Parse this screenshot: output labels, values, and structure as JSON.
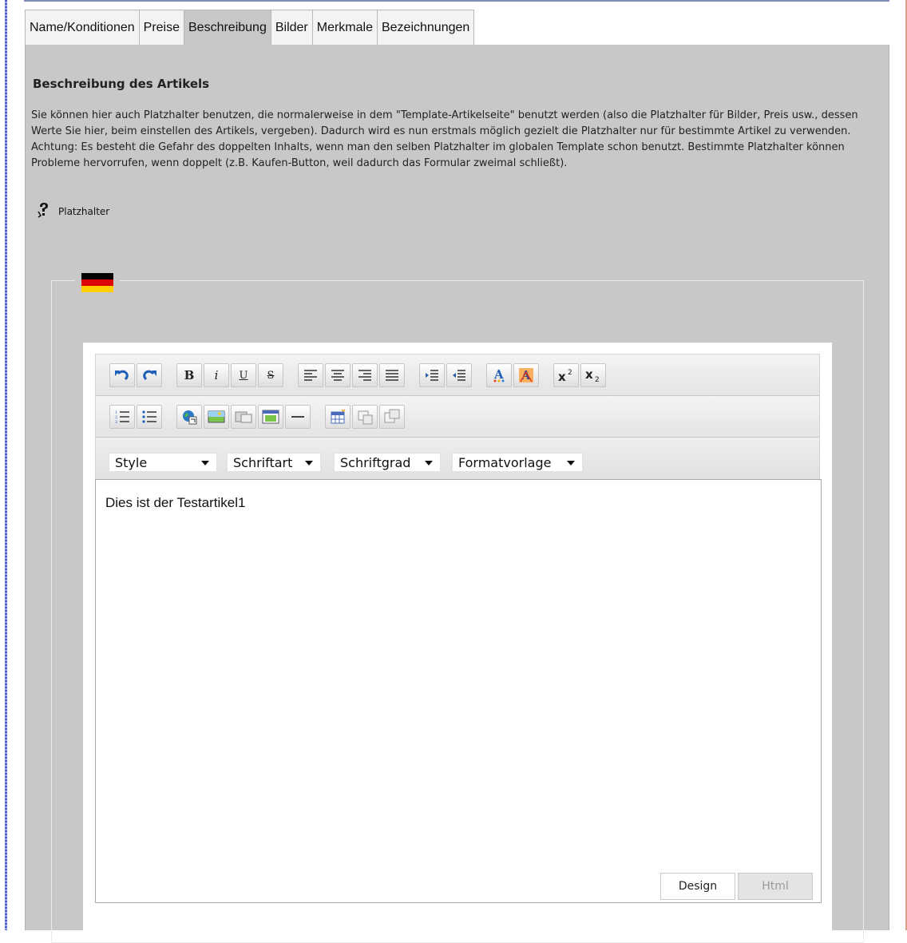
{
  "tabs": [
    {
      "label": "Name/Konditionen"
    },
    {
      "label": "Preise"
    },
    {
      "label": "Beschreibung"
    },
    {
      "label": "Bilder"
    },
    {
      "label": "Merkmale"
    },
    {
      "label": "Bezeichnungen"
    }
  ],
  "active_tab": "Beschreibung",
  "section": {
    "title": "Beschreibung des Artikels",
    "description": "Sie können hier auch Platzhalter benutzen, die normalerweise in dem \"Template-Artikelseite\" benutzt werden (also die Platzhalter für Bilder, Preis usw., dessen Werte Sie hier, beim einstellen des Artikels, vergeben). Dadurch wird es nun erstmals möglich gezielt die Platzhalter nur für bestimmte Artikel zu verwenden. Achtung: Es besteht die Gefahr des doppelten Inhalts, wenn man den selben Platzhalter im globalen Template schon benutzt. Bestimmte Platzhalter können Probleme hervorrufen, wenn doppelt (z.B. Kaufen-Button, weil dadurch das Formular zweimal schließt).",
    "placeholder_link": "Platzhalter"
  },
  "language_flag": "de-flag-icon",
  "toolbar": {
    "bold_glyph": "B",
    "italic_glyph": "i",
    "underline_glyph": "U",
    "strike_glyph": "S",
    "dropdowns": {
      "style": "Style",
      "font": "Schriftart",
      "size": "Schriftgrad",
      "format": "Formatvorlage"
    }
  },
  "editor": {
    "content": "Dies ist der Testartikel1"
  },
  "modes": {
    "design": "Design",
    "html": "Html",
    "active": "Design"
  },
  "colors": {
    "panel_bg": "#c8c8c8",
    "toolbar_bg": "#ececec"
  }
}
